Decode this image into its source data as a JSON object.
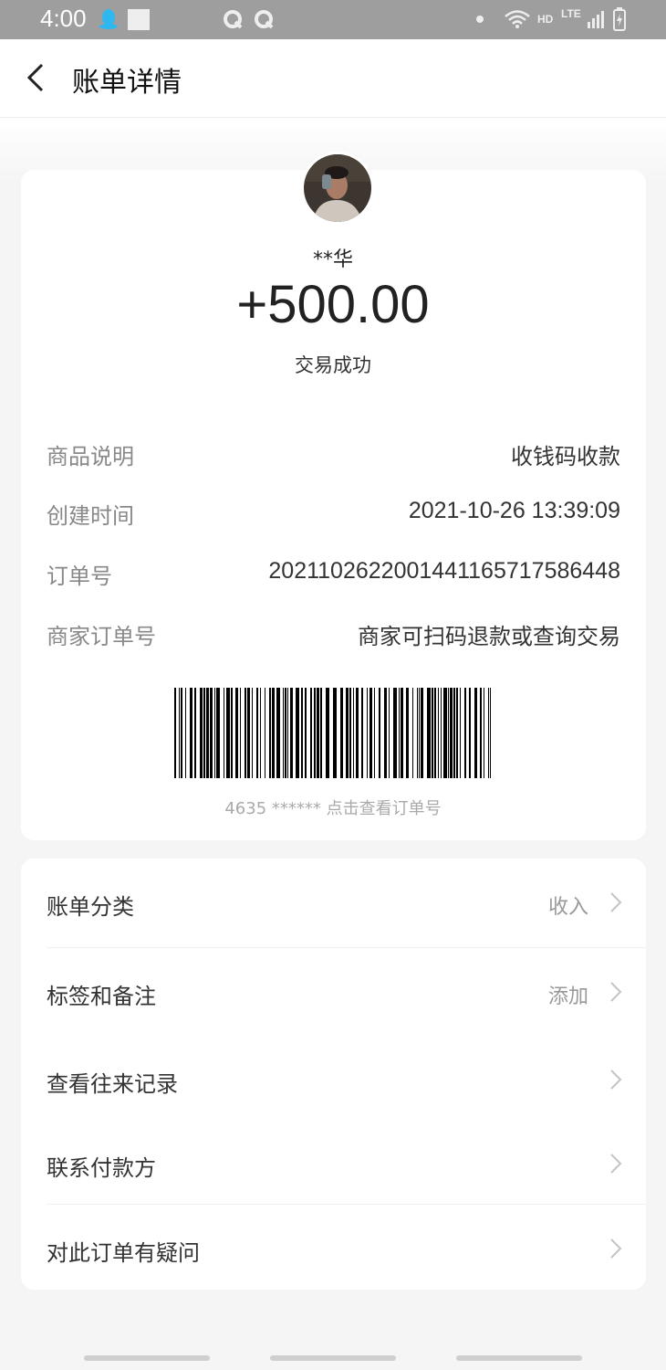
{
  "status_bar": {
    "time": "4:00",
    "hd": "HD",
    "lte": "LTE"
  },
  "header": {
    "title": "账单详情",
    "back_icon": "chevron-left-icon"
  },
  "transaction": {
    "name": "**华",
    "amount": "+500.00",
    "status": "交易成功",
    "details": [
      {
        "label": "商品说明",
        "value": "收钱码收款"
      },
      {
        "label": "创建时间",
        "value": "2021-10-26 13:39:09"
      },
      {
        "label": "订单号",
        "value": "2021102622001441165717586448"
      },
      {
        "label": "商家订单号",
        "value": "商家可扫码退款或查询交易"
      }
    ],
    "barcode_caption": "4635 ****** 点击查看订单号"
  },
  "menu": [
    {
      "label": "账单分类",
      "value": "收入"
    },
    {
      "label": "标签和备注",
      "value": "添加"
    },
    {
      "label": "查看往来记录",
      "value": ""
    },
    {
      "label": "联系付款方",
      "value": ""
    },
    {
      "label": "对此订单有疑问",
      "value": ""
    }
  ],
  "colors": {
    "status_bar": "#9e9e9e",
    "background": "#f5f5f5",
    "card": "#ffffff",
    "text_primary": "#333333",
    "text_secondary": "#888888"
  }
}
